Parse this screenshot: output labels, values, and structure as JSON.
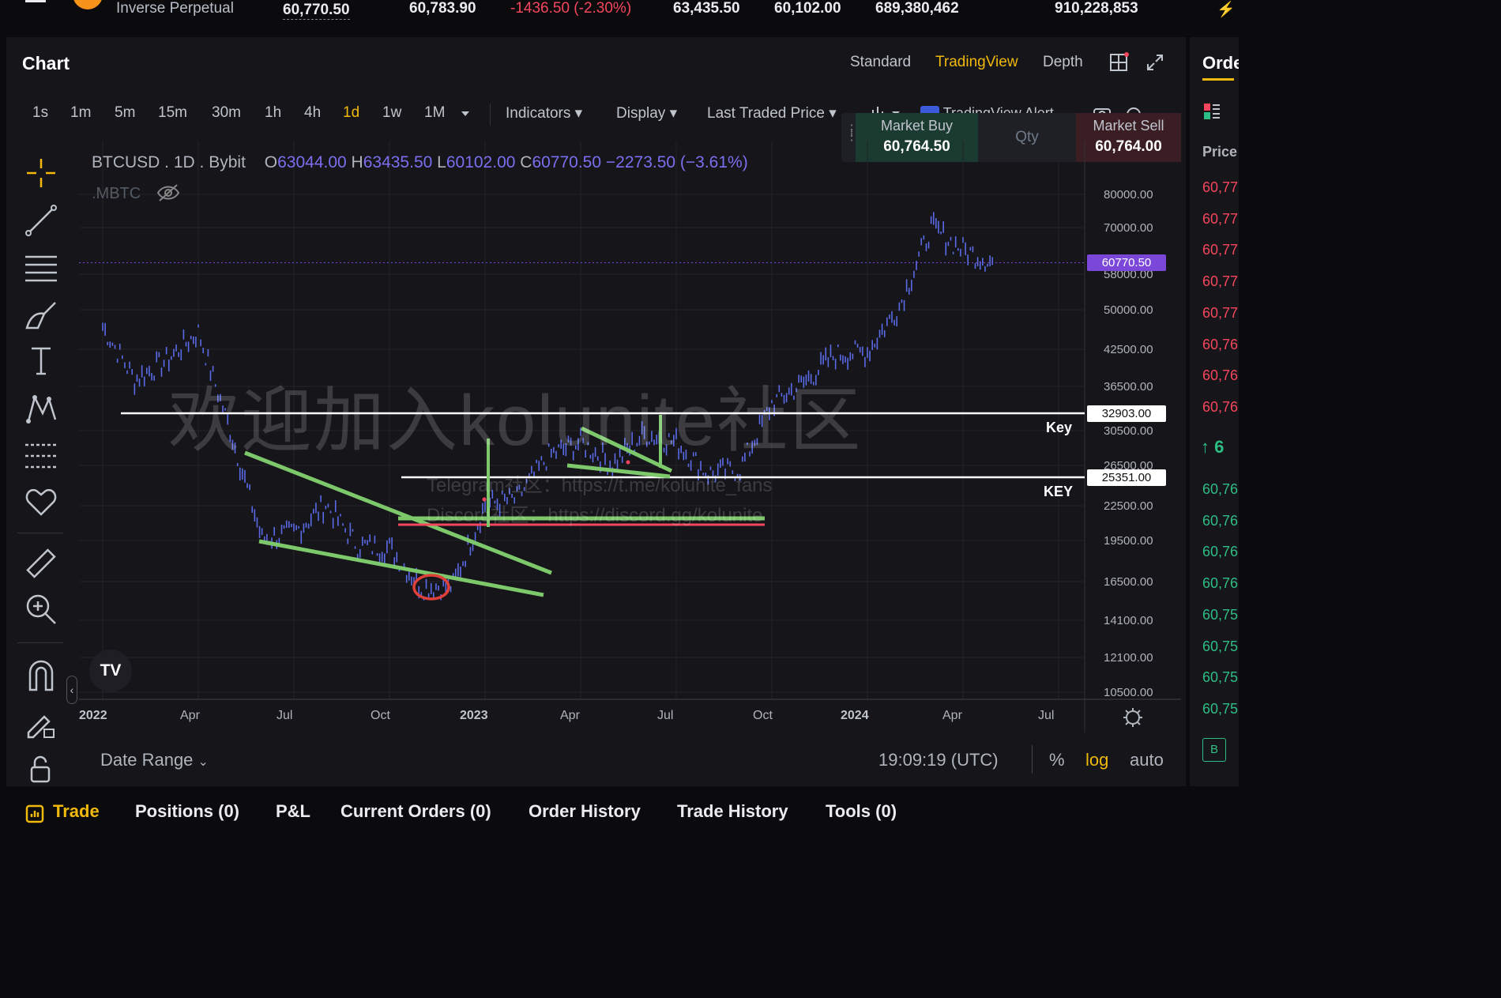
{
  "ticker": {
    "name": "Inverse Perpetual",
    "last_price": "60,770.50",
    "mark_price": "60,783.90",
    "change": "-1436.50 (-2.30%)",
    "high_24h": "63,435.50",
    "low_24h": "60,102.00",
    "volume_24h": "689,380,462",
    "turnover_24h": "910,228,853"
  },
  "chart_panel": {
    "title": "Chart",
    "views": [
      "Standard",
      "TradingView",
      "Depth"
    ],
    "active_view": "TradingView",
    "intervals": [
      "1s",
      "1m",
      "5m",
      "15m",
      "30m",
      "1h",
      "4h",
      "1d",
      "1w",
      "1M"
    ],
    "active_interval": "1d",
    "indicators_label": "Indicators",
    "display_label": "Display",
    "price_type_label": "Last Traded Price",
    "alert_label": "TradingView Alert"
  },
  "quick_trade": {
    "buy_label": "Market Buy",
    "buy_price": "60,764.50",
    "qty_placeholder": "Qty",
    "sell_label": "Market Sell",
    "sell_price": "60,764.00"
  },
  "legend": {
    "symbol": "BTCUSD",
    "interval": "1D",
    "exchange": "Bybit",
    "o_label": "O",
    "o_value": "63044.00",
    "h_label": "H",
    "h_value": "63435.50",
    "l_label": "L",
    "l_value": "60102.00",
    "c_label": "C",
    "c_value": "60770.50",
    "change": "−2273.50 (−3.61%)",
    "secondary_symbol": ".MBTC"
  },
  "watermark": {
    "main": "欢迎加入kolunite社区",
    "telegram": "Telegram社区：https://t.me/kolunite_fans",
    "discord": "Discord社区：https://discord.gg/kolunite"
  },
  "price_axis": [
    "80000.00",
    "70000.00",
    "58000.00",
    "50000.00",
    "42500.00",
    "36500.00",
    "30500.00",
    "26500.00",
    "22500.00",
    "19500.00",
    "16500.00",
    "14100.00",
    "12100.00",
    "10500.00"
  ],
  "current_price_tag": "60770.50",
  "levels": [
    {
      "price_label": "32903.00",
      "note": "Key"
    },
    {
      "price_label": "25351.00",
      "note": "KEY"
    }
  ],
  "date_axis": [
    "2022",
    "Apr",
    "Jul",
    "Oct",
    "2023",
    "Apr",
    "Jul",
    "Oct",
    "2024",
    "Apr",
    "Jul"
  ],
  "footer": {
    "date_range_label": "Date Range",
    "clock": "19:09:19 (UTC)",
    "percent_label": "%",
    "log_label": "log",
    "auto_label": "auto"
  },
  "right_panel": {
    "title": "Orde",
    "price_header": "Price",
    "asks": [
      "60,77",
      "60,77",
      "60,77",
      "60,77",
      "60,77",
      "60,76",
      "60,76",
      "60,76"
    ],
    "mid": "6",
    "bids": [
      "60,76",
      "60,76",
      "60,76",
      "60,76",
      "60,75",
      "60,75",
      "60,75",
      "60,75"
    ],
    "badge": "B"
  },
  "bottom_tabs": [
    "Trade",
    "Positions (0)",
    "P&L",
    "Current Orders (0)",
    "Order History",
    "Trade History",
    "Tools (0)"
  ],
  "colors": {
    "accent": "#f0b90b",
    "down": "#f6465d",
    "up": "#2ebd85",
    "candles": "#5b6be8",
    "ohlc_values": "#7b6ff0",
    "trendline": "#7cc86a",
    "level_line": "#ffffff",
    "price_tag": "#7b47d8"
  },
  "chart_data": {
    "type": "line",
    "title": "",
    "series": [
      {
        "name": "BTCUSD",
        "x": [
          "2022-01",
          "2022-02",
          "2022-03",
          "2022-04",
          "2022-05",
          "2022-06",
          "2022-07",
          "2022-08",
          "2022-09",
          "2022-10",
          "2022-11",
          "2022-12",
          "2023-01",
          "2023-02",
          "2023-03",
          "2023-04",
          "2023-05",
          "2023-06",
          "2023-07",
          "2023-08",
          "2023-09",
          "2023-10",
          "2023-11",
          "2023-12",
          "2024-01",
          "2024-02",
          "2024-03",
          "2024-04",
          "2024-05"
        ],
        "y": [
          47000,
          38000,
          41000,
          46000,
          31000,
          20000,
          20500,
          23000,
          19500,
          19300,
          16500,
          16600,
          23000,
          23500,
          28000,
          29500,
          27000,
          30500,
          29500,
          26000,
          26500,
          34500,
          37500,
          42000,
          42500,
          51000,
          70000,
          64000,
          60770
        ]
      }
    ],
    "ylim": [
      10500,
      80000
    ],
    "yscale": "log"
  }
}
